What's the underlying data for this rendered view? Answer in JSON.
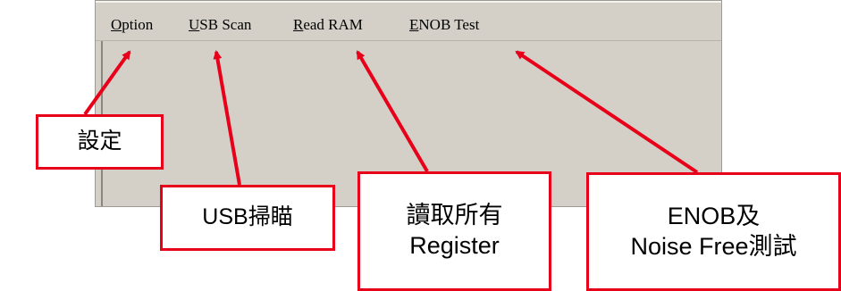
{
  "menu": {
    "option": {
      "accel": "O",
      "rest": "ption"
    },
    "usb_scan": {
      "accel": "U",
      "rest": "SB Scan"
    },
    "read_ram": {
      "accel": "R",
      "rest": "ead RAM"
    },
    "enob_test": {
      "accel": "E",
      "rest": "NOB Test"
    }
  },
  "callouts": {
    "option": [
      "設定"
    ],
    "usb_scan": [
      "USB掃瞄"
    ],
    "read_ram": [
      "讀取所有",
      "Register"
    ],
    "enob_test": [
      "ENOB及",
      "Noise Free測試"
    ]
  },
  "colors": {
    "annotation_red": "#e8001a",
    "window_face": "#d4d0c8"
  }
}
